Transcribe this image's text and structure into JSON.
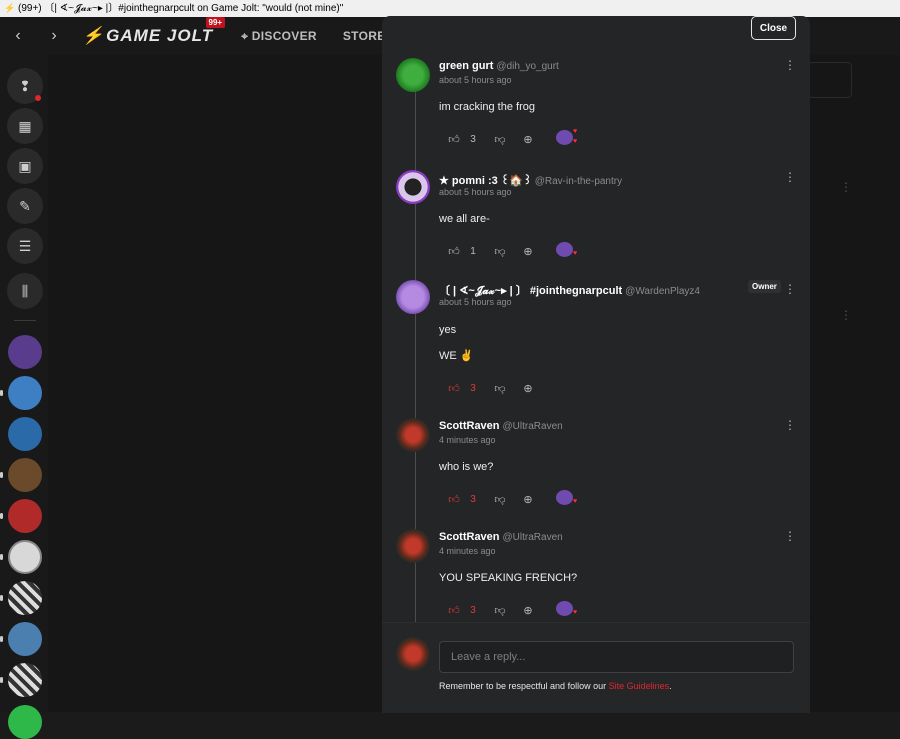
{
  "window": {
    "title": "(99+) 〔| ∢~𝓙𝓪𝔁~▸ |〕#jointhegnarpcult on Game Jolt: \"would (not mine)\""
  },
  "nav": {
    "logo_text": "GAME JOLT",
    "logo_badge": "99+",
    "discover_label": "DISCOVER",
    "store_label": "STORE",
    "more_icon": "kebab-icon"
  },
  "modal": {
    "close_label": "Close"
  },
  "comments": [
    {
      "name": "green gurt",
      "username": "@dih_yo_gurt",
      "time": "about 5 hours ago",
      "lines": [
        "im cracking the frog"
      ],
      "likes": "3",
      "liked": false,
      "has_reaction": true
    },
    {
      "name": "★ pomni :3 ꒰🏠꒱",
      "username": "@Rav-in-the-pantry",
      "time": "about 5 hours ago",
      "lines": [
        "we all are-"
      ],
      "likes": "1",
      "liked": false,
      "has_reaction": true
    },
    {
      "name": "〔 | ∢~𝓙𝓪𝔁~▸ | 〕 #jointhegnarpcult",
      "username": "@WardenPlayz4",
      "time": "about 5 hours ago",
      "badge": "Owner",
      "lines": [
        "yes",
        "WE ✌"
      ],
      "likes": "3",
      "liked": true,
      "has_reaction": false
    },
    {
      "name": "ScottRaven",
      "username": "@UltraRaven",
      "time": "4 minutes ago",
      "lines": [
        "who is we?"
      ],
      "likes": "3",
      "liked": true,
      "has_reaction": true
    },
    {
      "name": "ScottRaven",
      "username": "@UltraRaven",
      "time": "4 minutes ago",
      "lines": [
        "YOU SPEAKING FRENCH?"
      ],
      "likes": "3",
      "liked": true,
      "has_reaction": true
    }
  ],
  "reply": {
    "placeholder": "Leave a reply...",
    "guidelines_prefix": "Remember to be respectful and follow our ",
    "guidelines_link": "Site Guidelines",
    "guidelines_suffix": "."
  },
  "colors": {
    "accent_red": "#e0262f",
    "modal_bg": "#232526",
    "page_bg": "#1b1b1b"
  }
}
